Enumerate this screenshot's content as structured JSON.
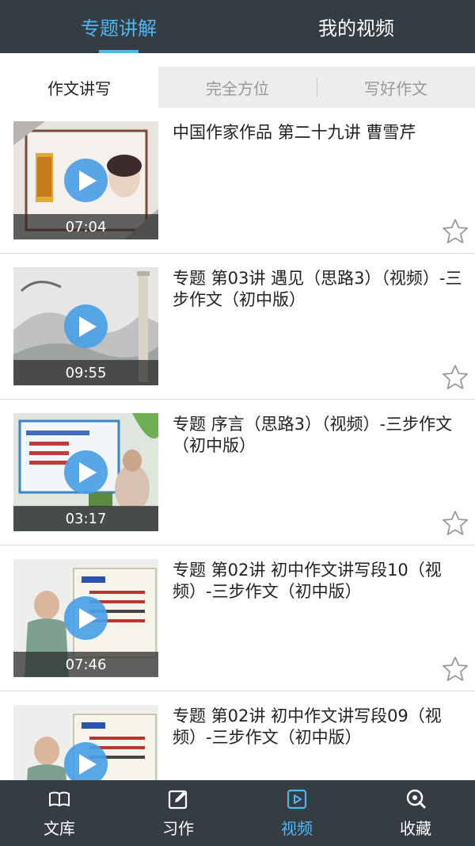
{
  "header": {
    "tabs": [
      {
        "label": "专题讲解",
        "active": true
      },
      {
        "label": "我的视频",
        "active": false
      }
    ]
  },
  "subtabs": [
    {
      "label": "作文讲写",
      "active": true
    },
    {
      "label": "完全方位",
      "active": false
    },
    {
      "label": "写好作文",
      "active": false
    }
  ],
  "videos": [
    {
      "title": "中国作家作品 第二十九讲 曹雪芹",
      "duration": "07:04",
      "favorited": false
    },
    {
      "title": "专题 第03讲 遇见（思路3）（视频）-三步作文（初中版）",
      "duration": "09:55",
      "favorited": false
    },
    {
      "title": "专题 序言（思路3）（视频）-三步作文（初中版）",
      "duration": "03:17",
      "favorited": false
    },
    {
      "title": "专题 第02讲 初中作文讲写段10（视频）-三步作文（初中版）",
      "duration": "07:46",
      "favorited": false
    },
    {
      "title": "专题 第02讲 初中作文讲写段09（视频）-三步作文（初中版）",
      "duration": "",
      "favorited": false
    }
  ],
  "bottom_nav": [
    {
      "label": "文库",
      "icon": "book-icon",
      "active": false
    },
    {
      "label": "习作",
      "icon": "edit-icon",
      "active": false
    },
    {
      "label": "视频",
      "icon": "play-square-icon",
      "active": true
    },
    {
      "label": "收藏",
      "icon": "search-favorite-icon",
      "active": false
    }
  ],
  "colors": {
    "bar_background": "#363c44",
    "accent": "#4fb7ef",
    "subtab_background": "#ededed",
    "play_button": "#4aa0e6"
  }
}
